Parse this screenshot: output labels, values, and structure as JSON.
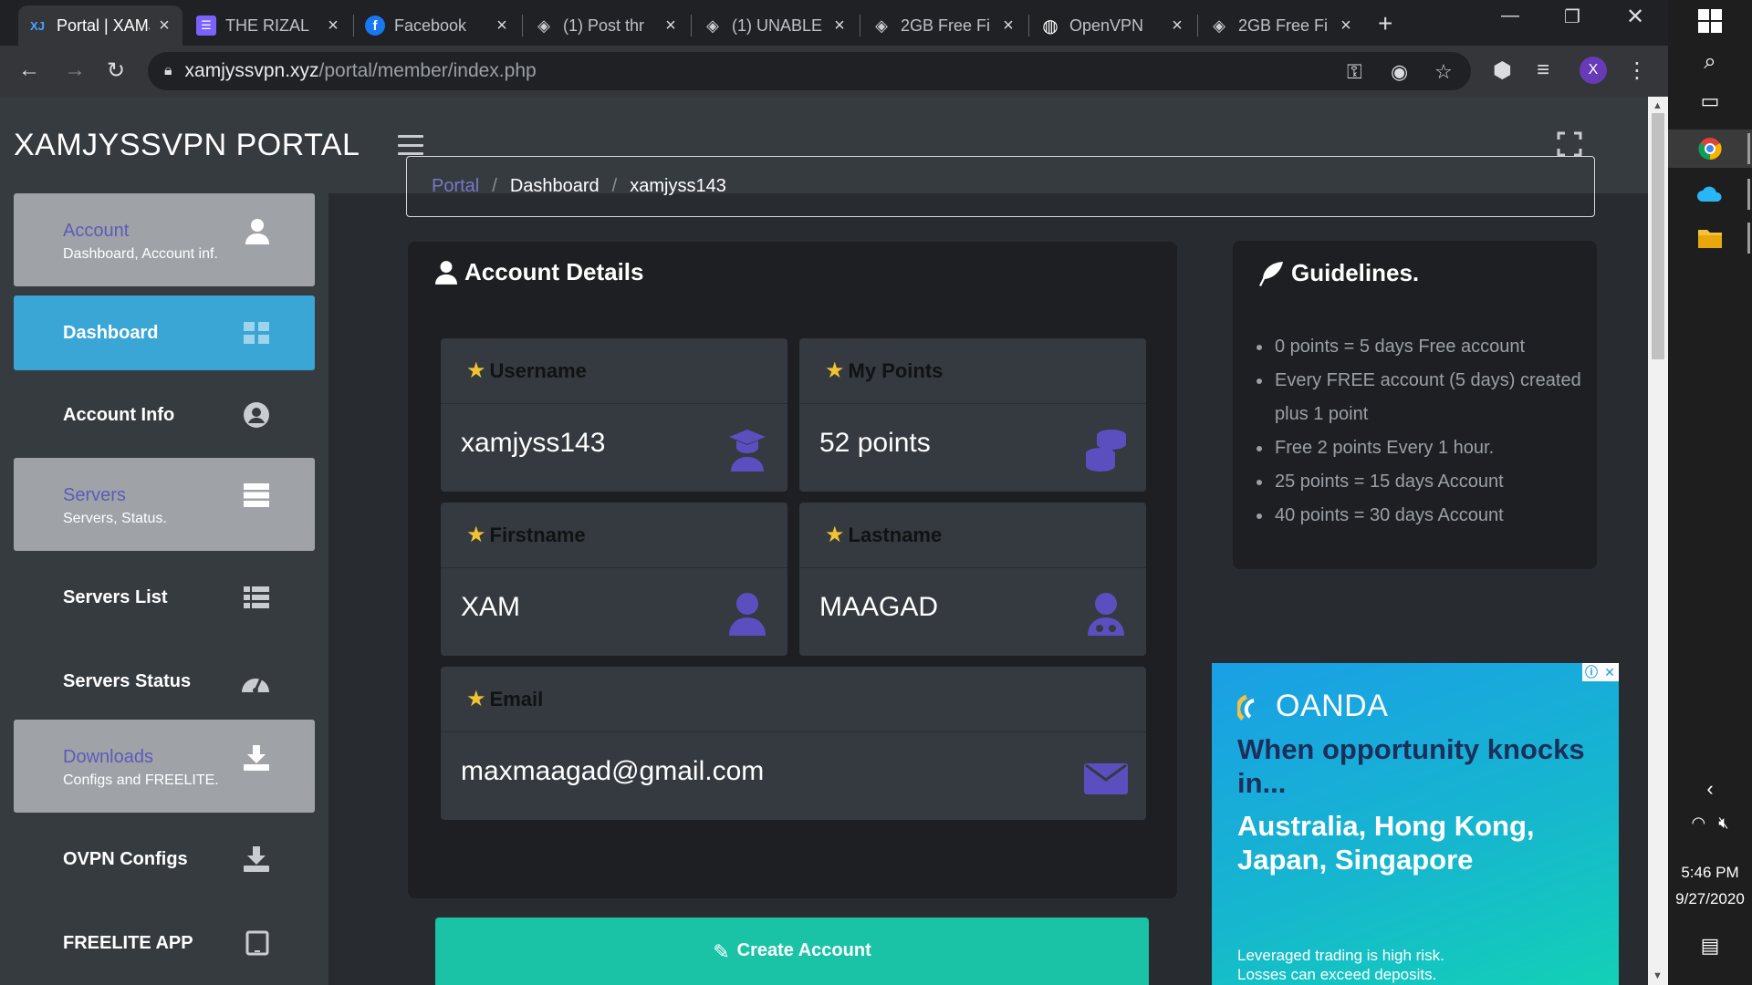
{
  "browser": {
    "tabs": [
      {
        "title": "Portal | XAMJYSSVPN",
        "fav_text": "XJ",
        "active": true
      },
      {
        "title": "THE RIZAL",
        "fav_text": "☰"
      },
      {
        "title": "Facebook",
        "fav_text": "f"
      },
      {
        "title": "(1) Post thr",
        "fav_text": "◈"
      },
      {
        "title": "(1) UNABLE",
        "fav_text": "◈"
      },
      {
        "title": "2GB Free Fi",
        "fav_text": "◈"
      },
      {
        "title": "OpenVPN",
        "fav_text": "◍"
      },
      {
        "title": "2GB Free Fi",
        "fav_text": "◈"
      }
    ],
    "url_host": "xamjyssvpn.xyz",
    "url_path": "/portal/member/index.php",
    "profile_initial": "X"
  },
  "header": {
    "brand": "XAMJYSSVPN PORTAL"
  },
  "sidebar": {
    "account_header": {
      "title": "Account",
      "subtitle": "Dashboard, Account inf."
    },
    "dashboard": "Dashboard",
    "account_info": "Account Info",
    "servers_header": {
      "title": "Servers",
      "subtitle": "Servers, Status."
    },
    "servers_list": "Servers List",
    "servers_status": "Servers Status",
    "downloads_header": {
      "title": "Downloads",
      "subtitle": "Configs and FREELITE."
    },
    "ovpn_configs": "OVPN Configs",
    "freelite_app": "FREELITE APP"
  },
  "breadcrumb": {
    "home": "Portal",
    "section": "Dashboard",
    "user": "xamjyss143",
    "separator": "/"
  },
  "account": {
    "title": "Account Details",
    "username_label": "Username",
    "username": "xamjyss143",
    "points_label": "My Points",
    "points": "52 points",
    "firstname_label": "Firstname",
    "firstname": "XAM",
    "lastname_label": "Lastname",
    "lastname": "MAAGAD",
    "email_label": "Email",
    "email": "maxmaagad@gmail.com",
    "create_button": "Create Account"
  },
  "guidelines": {
    "title": "Guidelines.",
    "items": [
      "0 points = 5 days Free account",
      "Every FREE account (5 days) created plus 1 point",
      "Free 2 points Every 1 hour.",
      "25 points = 15 days Account",
      "40 points = 30 days Account"
    ]
  },
  "ad": {
    "brand": "OANDA",
    "headline": "When opportunity knocks in...",
    "subhead": "Australia, Hong Kong, Japan, Singapore",
    "disclaimer_1": "Leveraged trading is high risk.",
    "disclaimer_2": "Losses can exceed deposits."
  },
  "taskbar": {
    "time": "5:46 PM",
    "date": "9/27/2020"
  },
  "colors": {
    "accent_blue": "#3aa6d6",
    "accent_teal": "#1bc3a6",
    "link_purple": "#7a77c9",
    "icon_purple": "#5b4fc0",
    "star_yellow": "#f1c232"
  }
}
